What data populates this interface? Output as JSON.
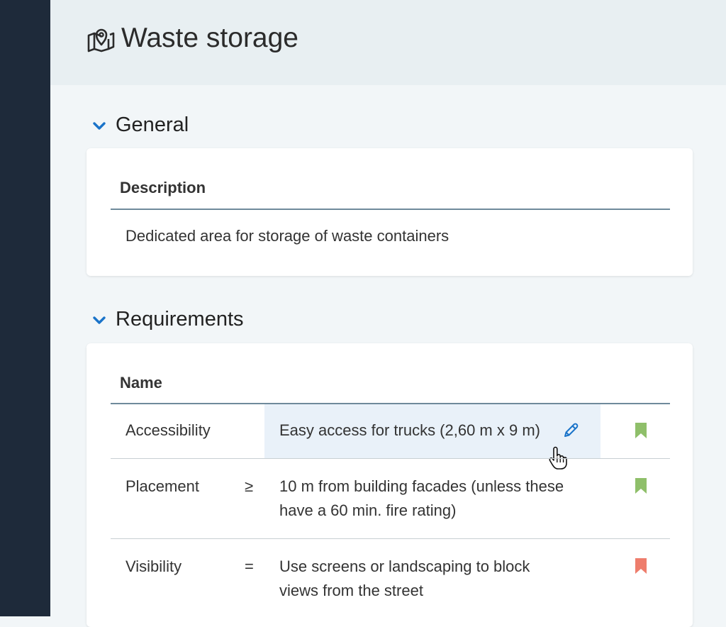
{
  "page": {
    "title": "Waste storage"
  },
  "icons": {
    "page_icon": "map-pin-icon",
    "section_toggle": "chevron-down-icon",
    "edit": "pencil-icon",
    "status": "bookmark-icon"
  },
  "colors": {
    "accent": "#1a73c9",
    "status_ok": "#8fbf6a",
    "status_fail": "#ee7d6c",
    "sidebar": "#1e2a3a"
  },
  "sections": {
    "general": {
      "title": "General",
      "column": "Description",
      "description": "Dedicated area for storage of waste containers"
    },
    "requirements": {
      "title": "Requirements",
      "column": "Name",
      "rows": [
        {
          "name": "Accessibility",
          "operator": "",
          "value": "Easy access for trucks (2,60 m x 9 m)",
          "status": "ok"
        },
        {
          "name": "Placement",
          "operator": "≥",
          "value_line1": "10 m from building facades (unless these",
          "value_line2": "have a 60 min. fire rating)",
          "status": "ok"
        },
        {
          "name": "Visibility",
          "operator": "=",
          "value_line1": "Use screens or landscaping to block",
          "value_line2": "views from the street",
          "status": "fail"
        }
      ]
    }
  }
}
